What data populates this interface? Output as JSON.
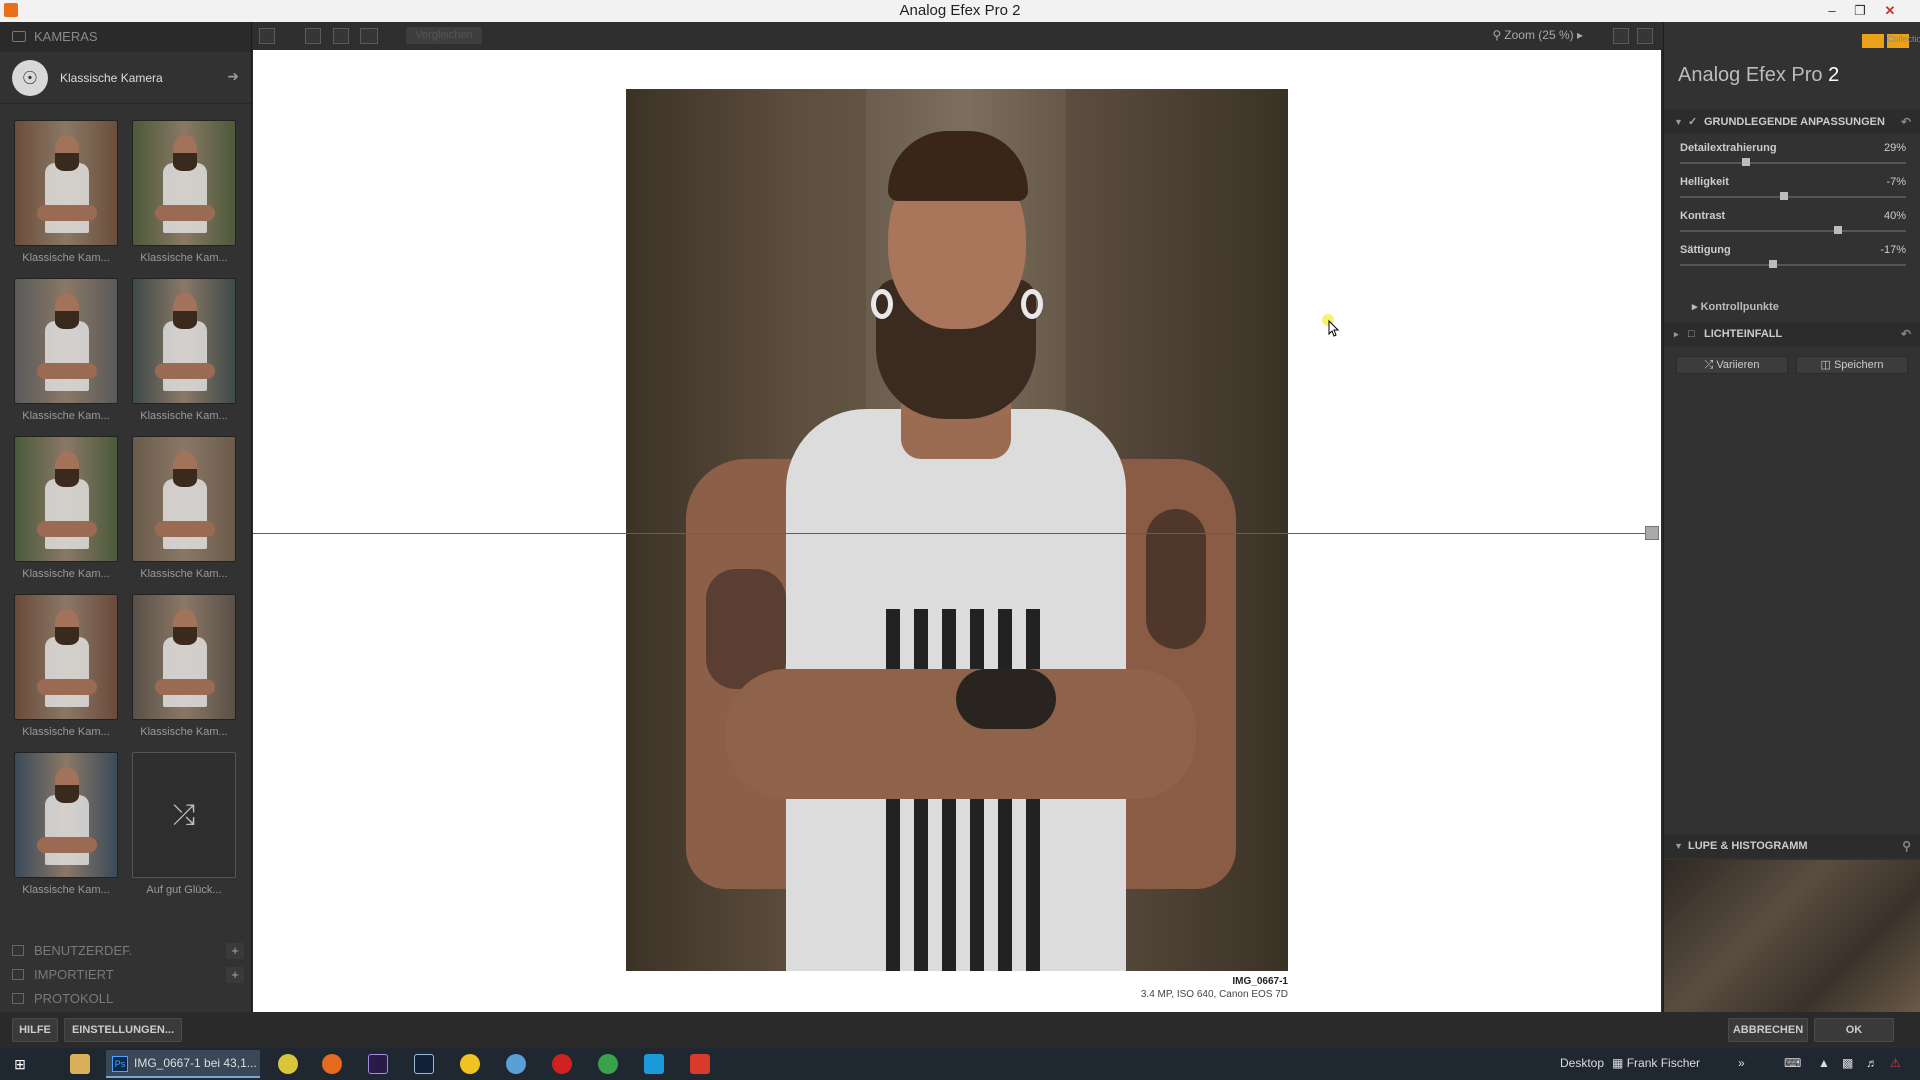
{
  "window": {
    "title": "Analog Efex Pro 2"
  },
  "left_panel": {
    "header": "KAMERAS",
    "camera_selector": "Klassische Kamera",
    "presets": [
      {
        "label": "Klassische Kam..."
      },
      {
        "label": "Klassische Kam..."
      },
      {
        "label": "Klassische Kam..."
      },
      {
        "label": "Klassische Kam..."
      },
      {
        "label": "Klassische Kam..."
      },
      {
        "label": "Klassische Kam..."
      },
      {
        "label": "Klassische Kam..."
      },
      {
        "label": "Klassische Kam..."
      },
      {
        "label": "Klassische Kam..."
      },
      {
        "label": "Auf gut Glück..."
      }
    ],
    "sections": {
      "custom": "BENUTZERDEF.",
      "imported": "IMPORTIERT",
      "history": "PROTOKOLL"
    }
  },
  "toolbar": {
    "compare_label": "Vergleichen",
    "zoom_label": "Zoom (25 %)"
  },
  "image": {
    "name": "IMG_0667-1",
    "info": "3.4 MP, ISO 640, Canon EOS 7D"
  },
  "right_panel": {
    "brand": "Analog Efex Pro",
    "brand_version": "2",
    "collection_label": "Collection",
    "basic_section": "GRUNDLEGENDE ANPASSUNGEN",
    "sliders": [
      {
        "label": "Detailextrahierung",
        "value": "29%",
        "fraction": 0.29
      },
      {
        "label": "Helligkeit",
        "value": "-7%",
        "fraction": 0.46
      },
      {
        "label": "Kontrast",
        "value": "40%",
        "fraction": 0.7
      },
      {
        "label": "Sättigung",
        "value": "-17%",
        "fraction": 0.41
      }
    ],
    "control_points": "Kontrollpunkte",
    "light_section": "LICHTEINFALL",
    "vary_label": "Variieren",
    "save_label": "Speichern",
    "loupe_section": "LUPE & HISTOGRAMM"
  },
  "bottom_bar": {
    "help_label": "HILFE",
    "settings_label": "EINSTELLUNGEN...",
    "cancel_label": "ABBRECHEN",
    "ok_label": "OK"
  },
  "taskbar": {
    "active_item": "IMG_0667-1 bei 43,1...",
    "desktop_label": "Desktop",
    "user_label": "Frank Fischer"
  }
}
